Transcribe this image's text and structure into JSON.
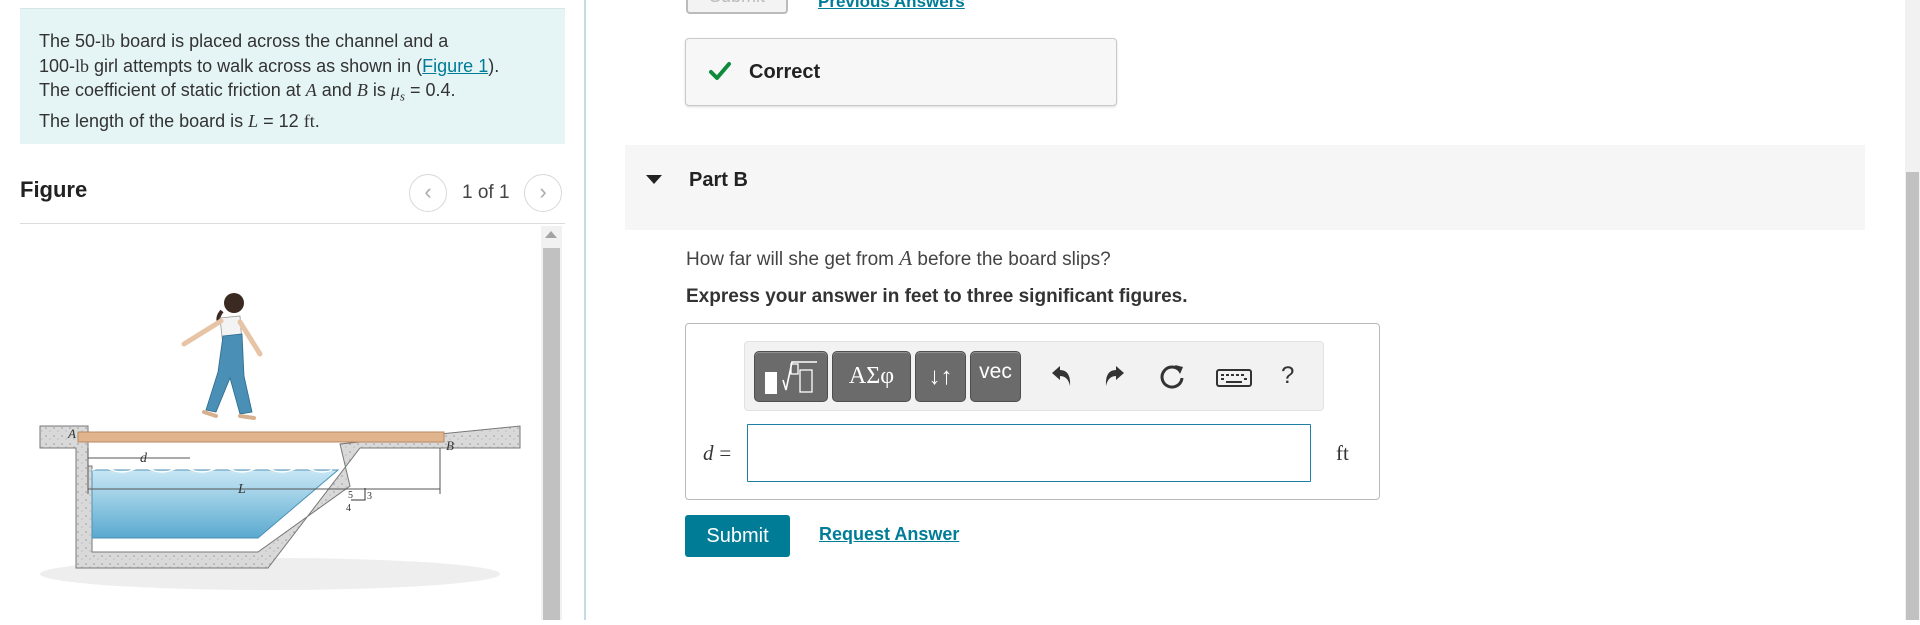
{
  "problem": {
    "text_1": "The 50-",
    "unit_lb_1": "lb",
    "text_2": " board is placed across the channel and a",
    "text_3": "100-",
    "unit_lb_2": "lb",
    "text_4": " girl attempts to walk across as shown in (",
    "figure_link": "Figure 1",
    "text_5": ").",
    "text_6": "The coefficient of static friction at ",
    "point_a": "A",
    "text_7": " and ",
    "point_b": "B",
    "text_8": " is ",
    "mu": "μ",
    "mu_sub": "s",
    "text_9": " = 0.4.",
    "text_10": "The length of the board is ",
    "var_l": "L",
    "text_11": " = 12 ",
    "unit_ft": "ft",
    "text_12": "."
  },
  "figure_panel": {
    "title": "Figure",
    "pager_count": "1 of 1",
    "prev_glyph": "‹",
    "next_glyph": "›",
    "labels": {
      "a": "A",
      "b": "B",
      "d": "d",
      "l": "L",
      "slope_5": "5",
      "slope_4": "4",
      "slope_3": "3"
    }
  },
  "previous_part": {
    "submit_label": "Submit",
    "previous_answers_label": "Previous Answers",
    "status": "Correct"
  },
  "part_b": {
    "title": "Part B",
    "question_pre": "How far will she get from ",
    "question_var": "A",
    "question_post": " before the board slips?",
    "instruction": "Express your answer in feet to three significant figures.",
    "toolbar": {
      "greek_label": "ΑΣφ",
      "arrows_label": "↓↑",
      "vec_label": "vec",
      "help_label": "?"
    },
    "variable_label": "d",
    "equals": "=",
    "input_value": "",
    "unit": "ft",
    "submit_label": "Submit",
    "request_answer_label": "Request Answer"
  },
  "colors": {
    "accent": "#007c97",
    "correct_green": "#0f8a3a",
    "problem_bg": "#e5f4f5"
  }
}
